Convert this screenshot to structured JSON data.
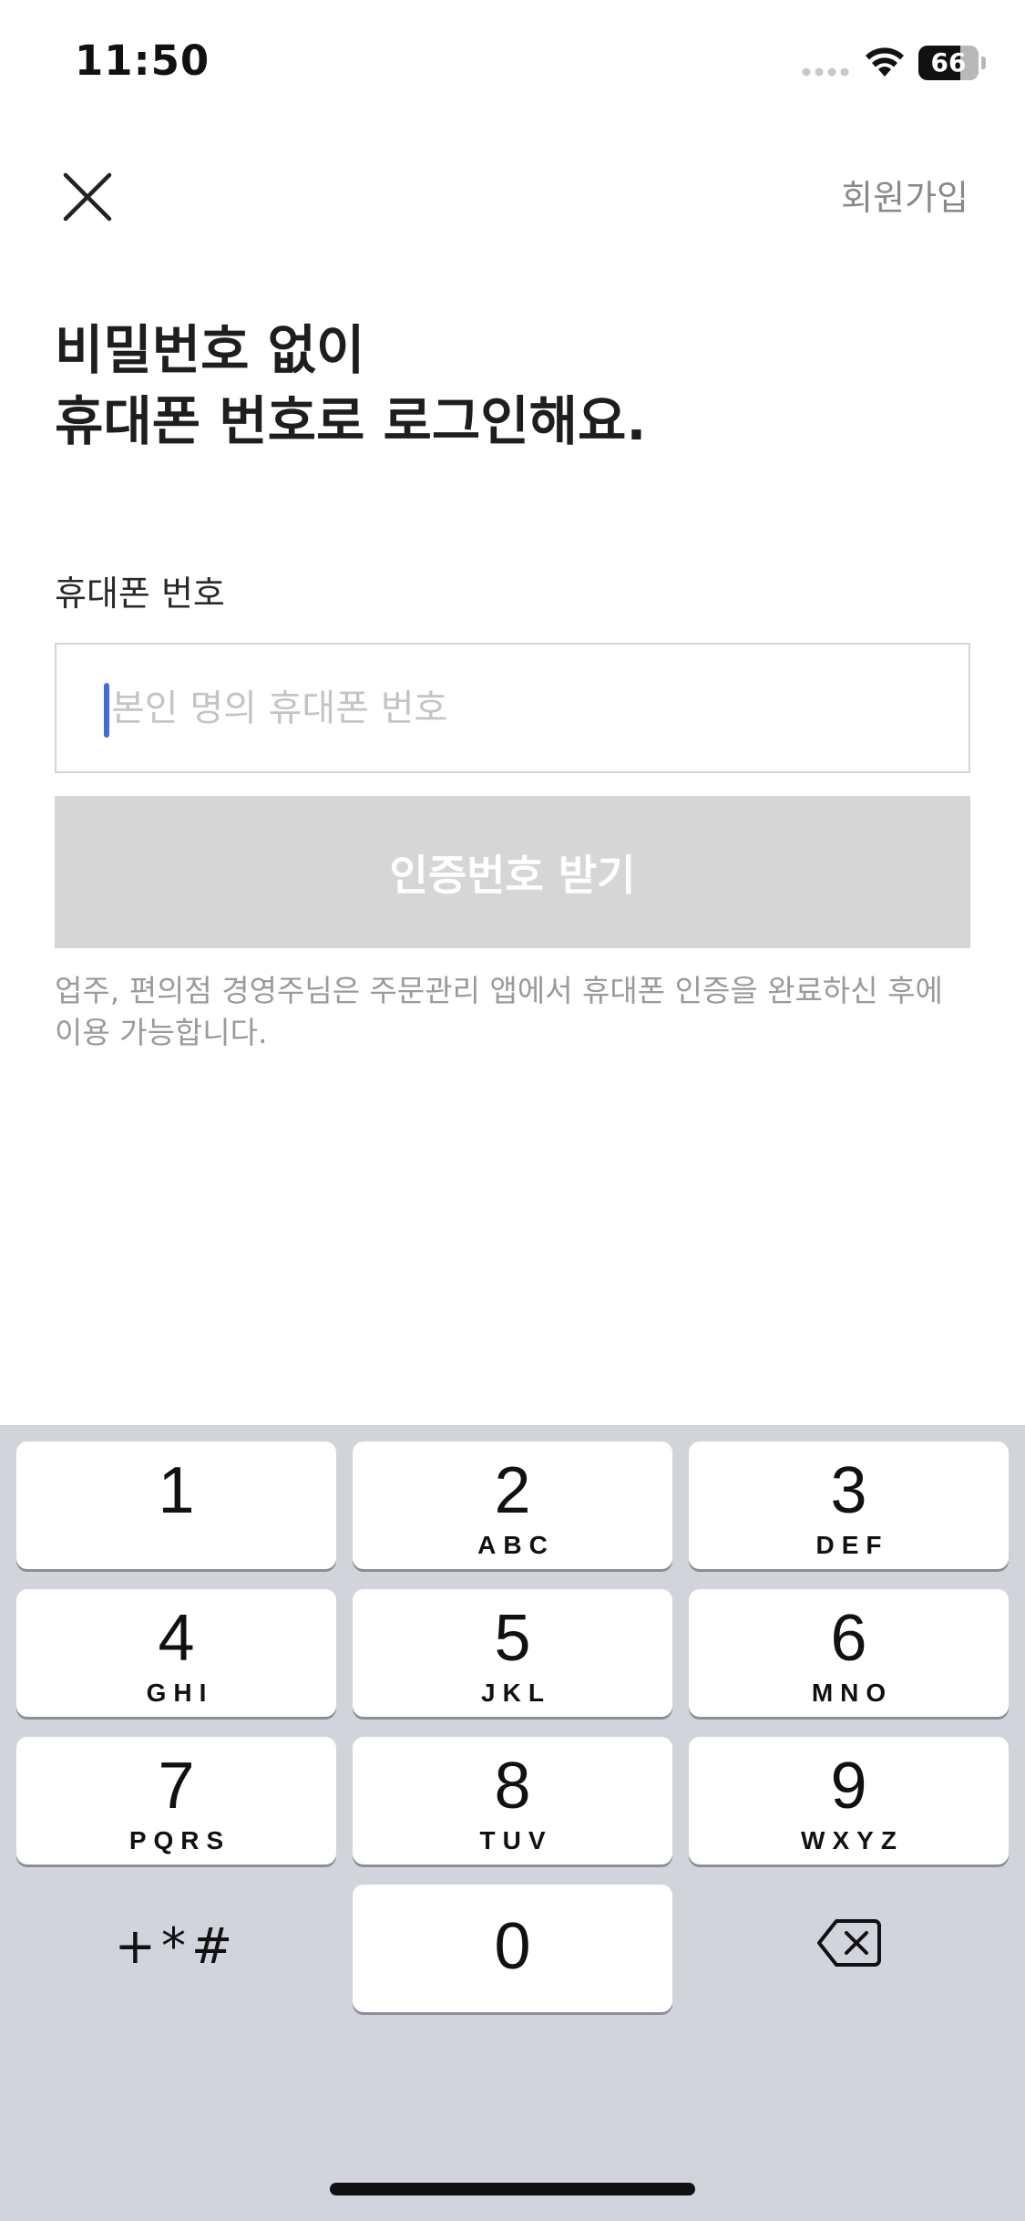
{
  "status_bar": {
    "time": "11:50",
    "battery_level": "66"
  },
  "nav": {
    "close_icon": "close-icon",
    "signup_label": "회원가입"
  },
  "headline": {
    "line1": "비밀번호 없이",
    "line2": "휴대폰 번호로 로그인해요."
  },
  "form": {
    "phone_label": "휴대폰 번호",
    "phone_value": "",
    "phone_placeholder": "본인 명의 휴대폰 번호",
    "verify_button_label": "인증번호 받기",
    "notice": "업주, 편의점 경영주님은 주문관리 앱에서 휴대폰 인증을 완료하신 후에 이용 가능합니다."
  },
  "keypad": {
    "keys": [
      {
        "digit": "1",
        "letters": ""
      },
      {
        "digit": "2",
        "letters": "ABC"
      },
      {
        "digit": "3",
        "letters": "DEF"
      },
      {
        "digit": "4",
        "letters": "GHI"
      },
      {
        "digit": "5",
        "letters": "JKL"
      },
      {
        "digit": "6",
        "letters": "MNO"
      },
      {
        "digit": "7",
        "letters": "PQRS"
      },
      {
        "digit": "8",
        "letters": "TUV"
      },
      {
        "digit": "9",
        "letters": "WXYZ"
      },
      {
        "digit": "0",
        "letters": ""
      }
    ],
    "symbols_label": "+*#",
    "delete_icon": "backspace-icon"
  },
  "colors": {
    "button_disabled": "#d6d6d6",
    "cursor": "#3f6be0",
    "keypad_background": "#d1d4da"
  }
}
